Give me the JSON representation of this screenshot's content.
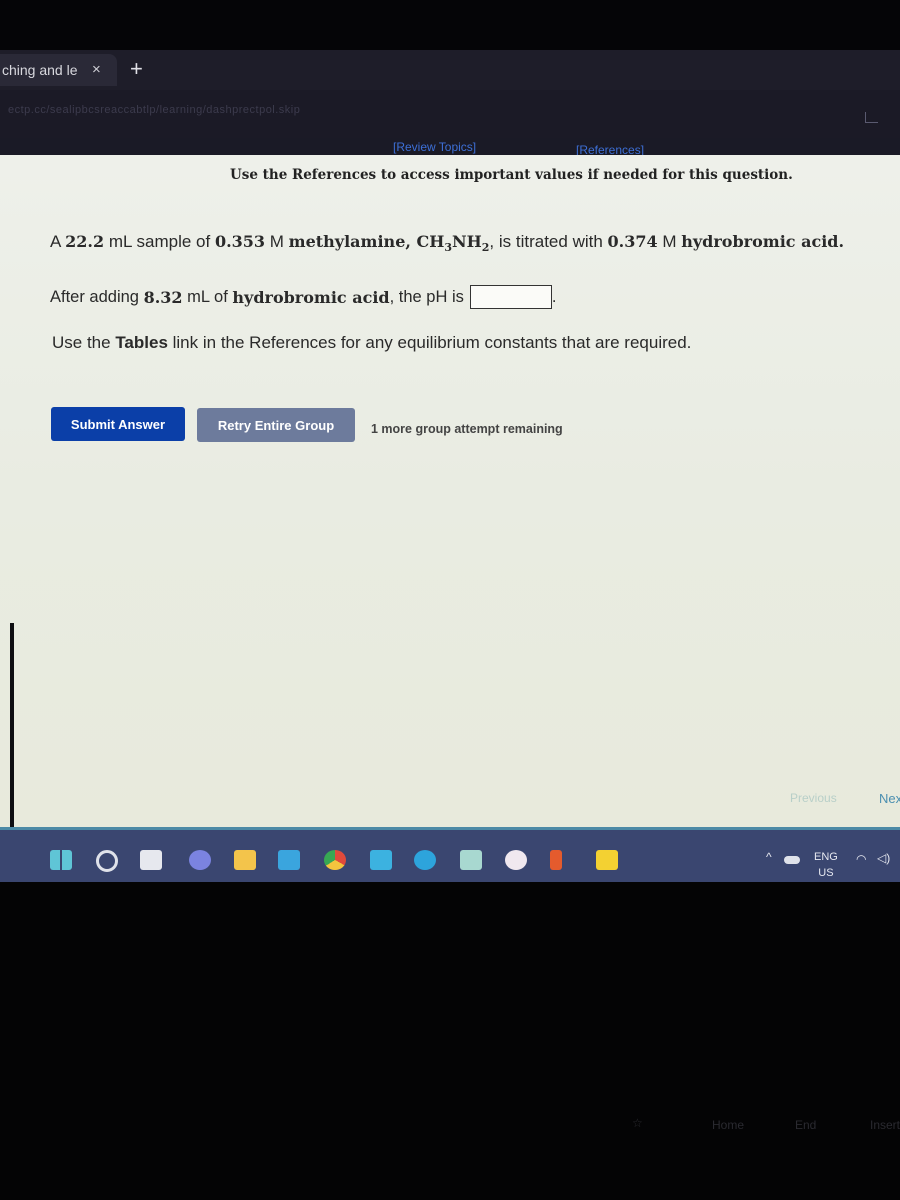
{
  "browser": {
    "tab_title": "ching and le",
    "tab_close": "×",
    "new_tab": "+",
    "address_text": "ectp.cc/sealipbcsreaccabtlp/learning/dashprectpol.skip"
  },
  "header": {
    "review_topics": "[Review Topics]",
    "references": "[References]",
    "notice": "Use the References to access important values if needed for this question."
  },
  "question": {
    "line1": {
      "t1": "A ",
      "volume": "22.2",
      "t2": " mL sample of ",
      "conc_base": "0.353",
      "t3": " M ",
      "base_name": "methylamine, CH",
      "sub1": "3",
      "base_mid": "NH",
      "sub2": "2",
      "t4": ", is titrated with ",
      "conc_acid": "0.374",
      "t5": " M ",
      "acid_name": "hydrobromic acid."
    },
    "line2": {
      "t1": "After adding ",
      "volume_added": "8.32",
      "t2": " mL of ",
      "acid_name": "hydrobromic acid",
      "t3": ", the pH is",
      "answer_value": "",
      "period": "."
    },
    "line3": {
      "t1": "Use the ",
      "tables": "Tables",
      "t2": " link in the References for any equilibrium constants that are required."
    }
  },
  "actions": {
    "submit": "Submit Answer",
    "retry": "Retry Entire Group",
    "attempts": "1 more group attempt remaining"
  },
  "nav": {
    "previous": "Previous",
    "next": "Next"
  },
  "taskbar": {
    "icons": [
      "windows-start",
      "search",
      "task-view",
      "meet",
      "file-explorer",
      "mail",
      "chrome",
      "l-app",
      "edge",
      "photos",
      "itunes",
      "office",
      "sticky-notes"
    ],
    "lang_top": "ENG",
    "lang_bottom": "US",
    "caret": "^"
  },
  "keyboard": {
    "keys": [
      "Home",
      "End",
      "Insert"
    ]
  }
}
